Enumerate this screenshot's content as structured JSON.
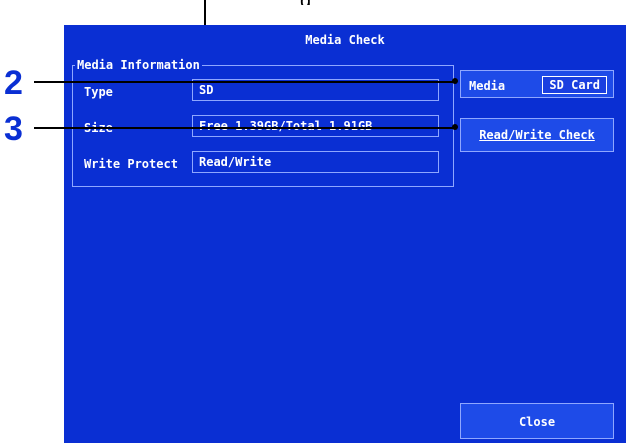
{
  "dialog": {
    "title": "Media Check"
  },
  "media_info": {
    "group_title": "Media Information",
    "type_label": "Type",
    "type_value": "SD",
    "size_label": "Size",
    "size_value": "Free 1.39GB/Total 1.91GB",
    "write_protect_label": "Write Protect",
    "write_protect_value": "Read/Write"
  },
  "actions": {
    "media_label": "Media",
    "media_value": "SD Card",
    "rw_check_label": "Read/Write Check",
    "close_label": "Close"
  },
  "callouts": {
    "step2": "2",
    "step3": "3",
    "top_caption": "g"
  },
  "colors": {
    "panel_bg": "#0a2fd3",
    "button_bg": "#1e4be8",
    "text": "#ffffff",
    "marker": "#0a2fd3"
  }
}
